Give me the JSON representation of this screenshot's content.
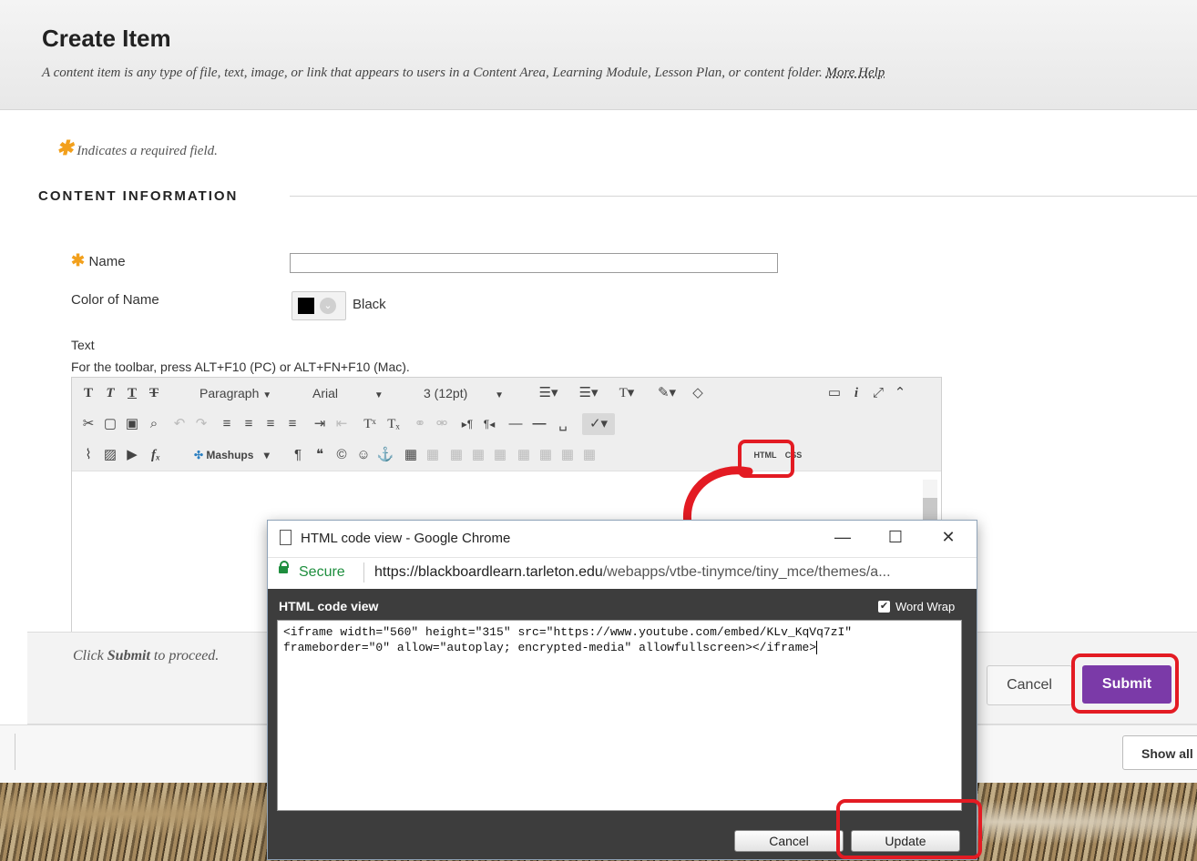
{
  "header": {
    "title": "Create Item",
    "description": "A content item is any type of file, text, image, or link that appears to users in a Content Area, Learning Module, Lesson Plan, or content folder.",
    "more_help": "More Help"
  },
  "form": {
    "required_note": "Indicates a required field.",
    "section_title": "CONTENT INFORMATION",
    "name_label": "Name",
    "name_value": "",
    "color_label": "Color of Name",
    "color_value": "Black",
    "color_swatch": "#000000",
    "text_label": "Text",
    "toolbar_hint": "For the toolbar, press ALT+F10 (PC) or ALT+FN+F10 (Mac)."
  },
  "editor": {
    "paragraph_select": "Paragraph",
    "font_select": "Arial",
    "size_select": "3 (12pt)",
    "mashups_label": "Mashups",
    "html_button": "HTML",
    "css_button": "CSS"
  },
  "footer": {
    "instruction_prefix": "Click ",
    "instruction_bold": "Submit",
    "instruction_suffix": " to proceed.",
    "cancel_label": "Cancel",
    "submit_label": "Submit",
    "submit_color": "#7b3aa8"
  },
  "downloads_bar": {
    "show_all_label": "Show all"
  },
  "popup": {
    "window_title": "HTML code view - Google Chrome",
    "secure_label": "Secure",
    "url_host": "https://blackboardlearn.tarleton.edu",
    "url_path": "/webapps/vtbe-tinymce/tiny_mce/themes/a...",
    "panel_title": "HTML code view",
    "word_wrap_label": "Word Wrap",
    "word_wrap_checked": true,
    "code_line1": "<iframe width=\"560\" height=\"315\" src=\"https://www.youtube.com/embed/KLv_KqVq7zI\"",
    "code_line2": "frameborder=\"0\" allow=\"autoplay; encrypted-media\" allowfullscreen></iframe>",
    "cancel_label": "Cancel",
    "update_label": "Update"
  },
  "colors": {
    "highlight": "#e31b23",
    "required_star": "#f2a01c",
    "secure_green": "#1e8e3e"
  }
}
